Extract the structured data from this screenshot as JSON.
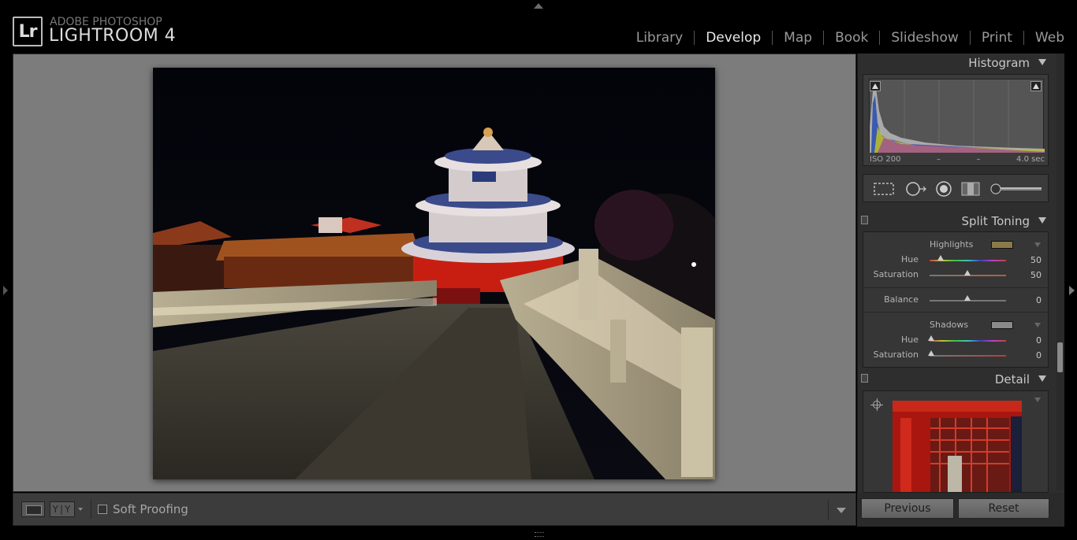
{
  "identity": {
    "logo_text": "Lr",
    "brand_small": "ADOBE PHOTOSHOP",
    "brand_large": "LIGHTROOM 4"
  },
  "modules": [
    "Library",
    "Develop",
    "Map",
    "Book",
    "Slideshow",
    "Print",
    "Web"
  ],
  "active_module": "Develop",
  "toolbar": {
    "yy_label": "Y|Y",
    "soft_proofing_label": "Soft Proofing",
    "soft_proofing_checked": false
  },
  "histogram": {
    "title": "Histogram",
    "iso": "ISO 200",
    "focal": "–",
    "aperture": "–",
    "shutter": "4.0 sec"
  },
  "split_toning": {
    "title": "Split Toning",
    "highlights_label": "Highlights",
    "highlights_color": "#8a7a4a",
    "highlights_hue_label": "Hue",
    "highlights_hue": "50",
    "highlights_saturation_label": "Saturation",
    "highlights_saturation": "50",
    "balance_label": "Balance",
    "balance": "0",
    "shadows_label": "Shadows",
    "shadows_color": "#8a8a8a",
    "shadows_hue_label": "Hue",
    "shadows_hue": "0",
    "shadows_saturation_label": "Saturation",
    "shadows_saturation": "0"
  },
  "detail": {
    "title": "Detail"
  },
  "buttons": {
    "previous": "Previous",
    "reset": "Reset"
  },
  "colors": {
    "background": "#000000",
    "canvas": "#7c7c7c",
    "panel": "#2e2e2e"
  }
}
